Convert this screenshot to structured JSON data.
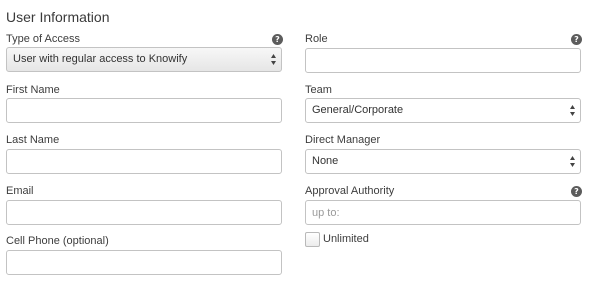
{
  "section": {
    "title": "User Information"
  },
  "left": {
    "type_of_access": {
      "label": "Type of Access",
      "value": "User with regular access to Knowify"
    },
    "first_name": {
      "label": "First Name",
      "value": ""
    },
    "last_name": {
      "label": "Last Name",
      "value": ""
    },
    "email": {
      "label": "Email",
      "value": ""
    },
    "cell_phone": {
      "label": "Cell Phone (optional)",
      "value": ""
    }
  },
  "right": {
    "role": {
      "label": "Role",
      "value": ""
    },
    "team": {
      "label": "Team",
      "value": "General/Corporate"
    },
    "direct_manager": {
      "label": "Direct Manager",
      "value": "None"
    },
    "approval_authority": {
      "label": "Approval Authority",
      "placeholder": "up to:",
      "value": ""
    },
    "unlimited": {
      "label": "Unlimited",
      "checked": false
    }
  },
  "icons": {
    "help": "question-mark-circle-icon",
    "select_arrows": "up-down-arrows-icon"
  },
  "colors": {
    "border": "#c3c3c3",
    "text": "#3d3d3d",
    "help_icon": "#5c5c5c"
  }
}
